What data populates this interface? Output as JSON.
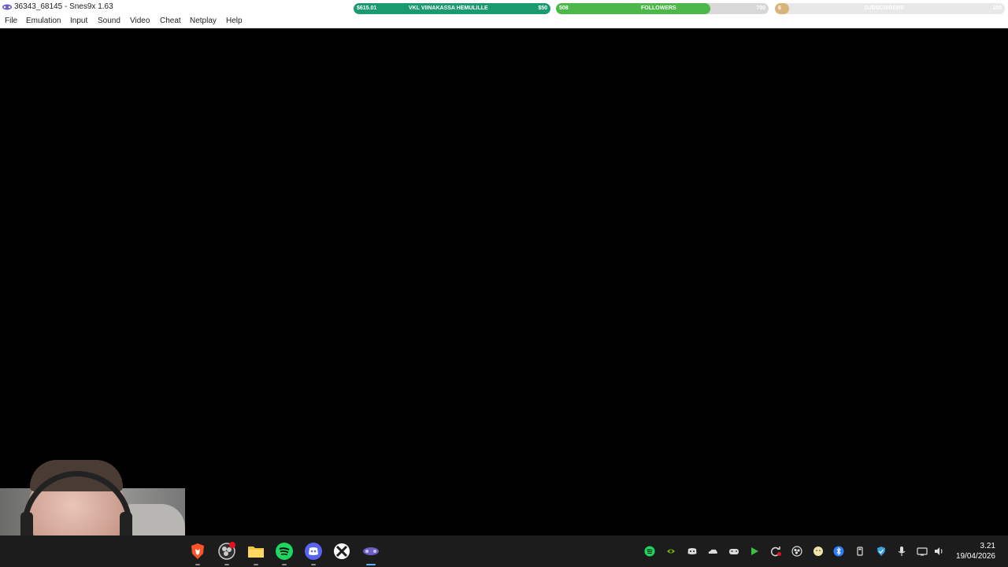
{
  "window": {
    "title": "36343_68145 - Snes9x 1.63",
    "app_icon": "snes9x-icon",
    "controls": [
      "minimize-icon",
      "restore-icon",
      "close-icon"
    ]
  },
  "menu": {
    "items": [
      "File",
      "Emulation",
      "Input",
      "Sound",
      "Video",
      "Cheat",
      "Netplay",
      "Help"
    ]
  },
  "stream_goals": {
    "donation": {
      "current": "$615.01",
      "label": "VKL VIINAKASSA HEMULILLE",
      "target": "$50",
      "color": "#1a9a6e",
      "progress": 1.0
    },
    "followers": {
      "current": "508",
      "label": "FOLLOWERS",
      "target": "700",
      "color": "#4cb84a",
      "progress": 0.726
    },
    "subscribers": {
      "current": "6",
      "label": "SUBSCRIBERS",
      "target": "100",
      "color": "#d9b47a",
      "progress": 0.06
    }
  },
  "taskbar": {
    "apps": [
      "brave-icon",
      "obs-icon",
      "file-explorer-icon",
      "spotify-icon",
      "discord-icon",
      "xbox-icon",
      "snes9x-icon"
    ],
    "active_app": "snes9x-icon",
    "tray": [
      "spotify-icon",
      "nvidia-icon",
      "discord-icon",
      "onedrive-icon",
      "controller-icon",
      "play-icon",
      "sync-icon",
      "obs-icon",
      "face-icon",
      "bluetooth-icon",
      "usb-icon",
      "shield-icon",
      "mic-icon",
      "network-icon",
      "volume-icon"
    ],
    "clock": {
      "time": "3.21",
      "date": "19/04/2026"
    }
  }
}
